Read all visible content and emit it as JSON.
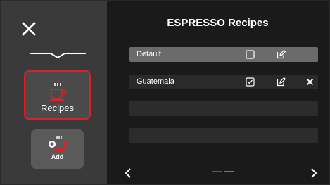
{
  "colors": {
    "accent": "#d8222a",
    "sidebar_bg": "#3a3a3a",
    "main_bg": "#1a1a1a",
    "row_selected": "#6b6b6b",
    "row_normal": "#2a2a2a"
  },
  "sidebar": {
    "close_icon": "close-icon",
    "tiles": [
      {
        "label": "Recipes",
        "icon": "coffee-cup-icon",
        "selected": true
      },
      {
        "label": "Add",
        "icon": "add-coffee-cup-icon",
        "selected": false
      }
    ]
  },
  "main": {
    "title": "ESPRESSO Recipes",
    "recipes": [
      {
        "name": "Default",
        "checked": false,
        "editable": true,
        "deletable": false,
        "selected": true
      },
      {
        "name": "Guatemala",
        "checked": true,
        "editable": true,
        "deletable": true,
        "selected": false
      }
    ],
    "empty_slots": 2,
    "pager": {
      "page": 1,
      "pages": 2
    }
  }
}
